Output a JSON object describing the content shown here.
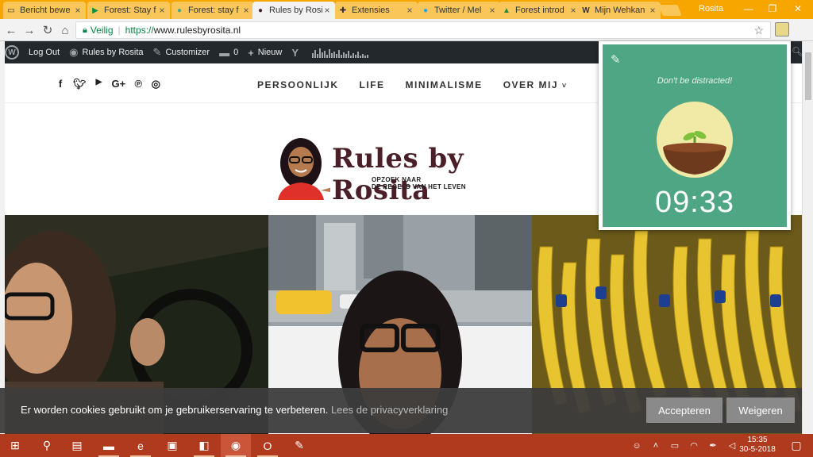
{
  "browser": {
    "tabs": [
      {
        "label": "Bericht bewe",
        "icon": "document-icon",
        "active": false
      },
      {
        "label": "Forest: Stay f",
        "icon": "play-store-icon",
        "active": false
      },
      {
        "label": "Forest: stay f",
        "icon": "forest-icon",
        "active": false
      },
      {
        "label": "Rules by Rosi",
        "icon": "rosita-icon",
        "active": true
      },
      {
        "label": "Extensies",
        "icon": "puzzle-icon",
        "active": false
      },
      {
        "label": "Twitter / Mel",
        "icon": "twitter-icon",
        "active": false
      },
      {
        "label": "Forest introd",
        "icon": "drive-icon",
        "active": false
      },
      {
        "label": "Mijn Wehkan",
        "icon": "w-icon",
        "active": false
      }
    ],
    "profile_name": "Rosita",
    "address": {
      "secure_label": "Veilig",
      "protocol": "https://",
      "host": "www.rulesbyrosita.nl"
    }
  },
  "adminbar": {
    "logout": "Log Out",
    "site_name": "Rules by Rosita",
    "customizer": "Customizer",
    "comments_count": "0",
    "new_label": "Nieuw"
  },
  "site": {
    "nav": [
      "PERSOONLIJK",
      "LIFE",
      "MINIMALISME",
      "OVER MIJ"
    ],
    "logo_title": "Rules by Rosita",
    "logo_sub_left": "OPZOEK NAAR",
    "logo_sub_right": "DE REGELS VAN HET LEVEN"
  },
  "cookie": {
    "text": "Er worden cookies gebruikt om je gebruikerservaring te verbeteren.",
    "link": "Lees de privacyverklaring",
    "accept": "Accepteren",
    "decline": "Weigeren"
  },
  "forest": {
    "motto": "Don't be distracted!",
    "timer": "09:33",
    "colors": {
      "bg": "#4fa684",
      "pot_bg": "#f1e9a6",
      "soil": "#6e3a1e",
      "sprout": "#7cc23a"
    }
  },
  "taskbar": {
    "time": "15:35",
    "date": "30-5-2018"
  }
}
